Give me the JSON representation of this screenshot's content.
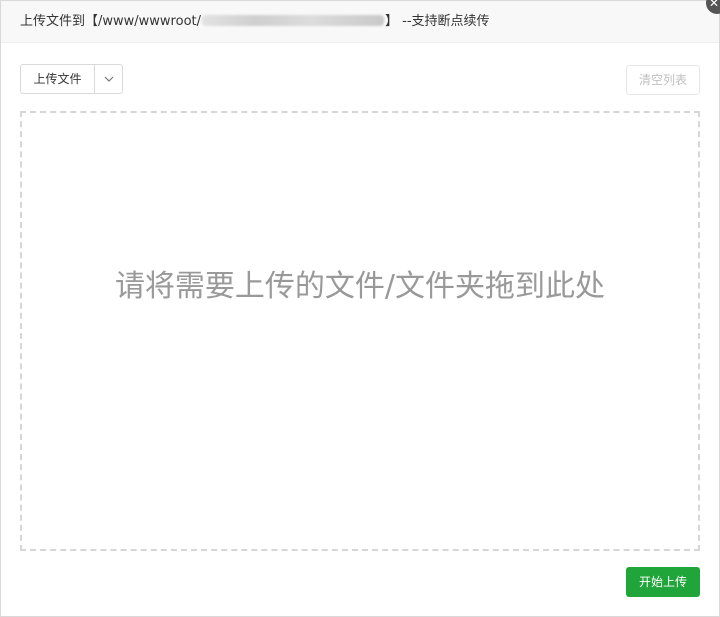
{
  "dialog": {
    "title_prefix": "上传文件到【/www/wwwroot/",
    "title_suffix": "】 --支持断点续传",
    "close_glyph": "✕"
  },
  "toolbar": {
    "upload_label": "上传文件",
    "clear_label": "清空列表"
  },
  "dropzone": {
    "hint": "请将需要上传的文件/文件夹拖到此处"
  },
  "footer": {
    "start_label": "开始上传"
  },
  "colors": {
    "primary": "#20a53a",
    "dashed_border": "#d6d6d6",
    "hint_text": "#999999"
  }
}
